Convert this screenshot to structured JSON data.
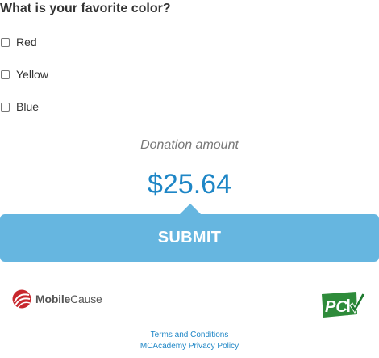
{
  "question": "What is your favorite color?",
  "options": [
    {
      "label": "Red",
      "checked": false
    },
    {
      "label": "Yellow",
      "checked": false
    },
    {
      "label": "Blue",
      "checked": false
    }
  ],
  "donation": {
    "label": "Donation amount",
    "amount": "$25.64"
  },
  "submit_label": "SUBMIT",
  "logos": {
    "mobilecause": {
      "part1": "Mobile",
      "part2": "Cause"
    },
    "pci": "PCI"
  },
  "footer": {
    "terms": "Terms and Conditions",
    "privacy": "MCAcademy Privacy Policy"
  },
  "colors": {
    "accent": "#1e86c6",
    "submit_bg": "#66b6e0",
    "mobilecause_red": "#c8272d",
    "pci_green": "#2e8b3a"
  }
}
